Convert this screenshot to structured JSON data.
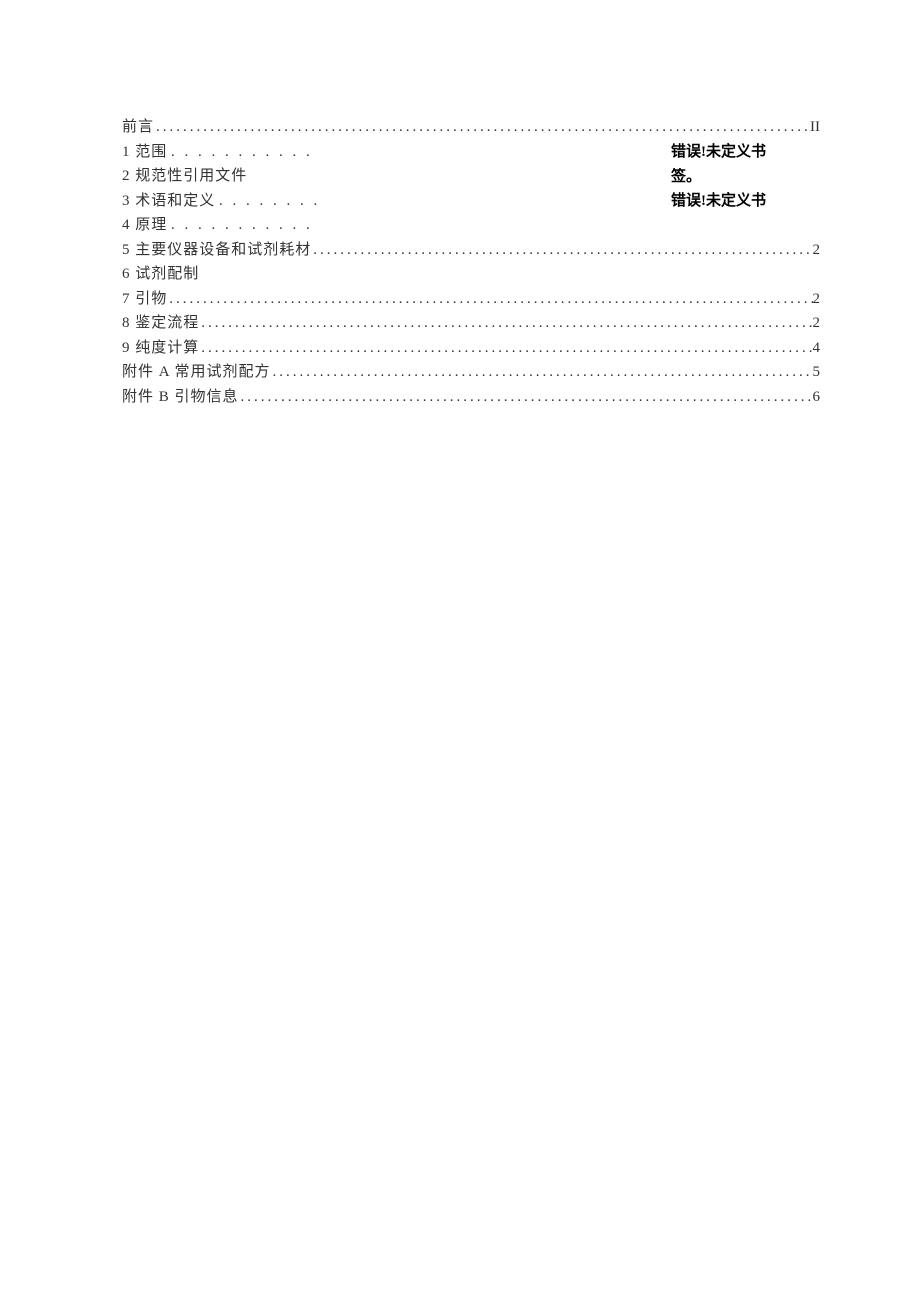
{
  "toc": {
    "entries": [
      {
        "label": "前言",
        "type": "full",
        "page": "II"
      },
      {
        "label": "1 范围",
        "type": "short",
        "trail": ". . . . . . . . . . ."
      },
      {
        "label": "2 规范性引用文件",
        "type": "nolead",
        "trail": ""
      },
      {
        "label": "3 术语和定义",
        "type": "short",
        "trail": ". . . . . . . ."
      },
      {
        "label": "4 原理",
        "type": "short",
        "trail": ". . . . . . . . . . ."
      },
      {
        "label": "5 主要仪器设备和试剂耗材",
        "type": "full",
        "page": "2"
      },
      {
        "label": "6 试剂配制",
        "type": "nolead",
        "trail": ""
      },
      {
        "label": "7 引物",
        "type": "full",
        "page": "2"
      },
      {
        "label": "8 鉴定流程",
        "type": "full",
        "page": "2"
      },
      {
        "label": "9 纯度计算",
        "type": "full",
        "page": "4"
      },
      {
        "label": "附件 A 常用试剂配方",
        "type": "full",
        "page": "5"
      },
      {
        "label": "附件 B 引物信息",
        "type": "full",
        "page": "6"
      }
    ]
  },
  "errors": {
    "line1": "错误!未定义书",
    "line2": "签。",
    "line3": "错误!未定义书"
  }
}
